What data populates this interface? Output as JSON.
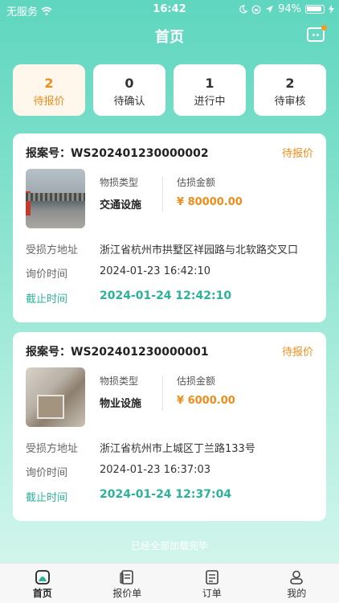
{
  "status_bar": {
    "carrier": "无服务",
    "time": "16:42",
    "battery": "94%"
  },
  "header": {
    "title": "首页"
  },
  "tabs": [
    {
      "count": "2",
      "label": "待报价",
      "active": true
    },
    {
      "count": "0",
      "label": "待确认"
    },
    {
      "count": "1",
      "label": "进行中"
    },
    {
      "count": "2",
      "label": "待审核"
    }
  ],
  "cards": [
    {
      "case_label": "报案号：",
      "case_no": "WS202401230000002",
      "status": "待报价",
      "type_label": "物损类型",
      "type_value": "交通设施",
      "amount_label": "估损金额",
      "amount_value": "¥ 80000.00",
      "address_label": "受损方地址",
      "address_value": "浙江省杭州市拱墅区祥园路与北软路交叉口",
      "inquiry_label": "询价时间",
      "inquiry_value": "2024-01-23 16:42:10",
      "deadline_label": "截止时间",
      "deadline_value": "2024-01-24 12:42:10"
    },
    {
      "case_label": "报案号：",
      "case_no": "WS202401230000001",
      "status": "待报价",
      "type_label": "物损类型",
      "type_value": "物业设施",
      "amount_label": "估损金额",
      "amount_value": "¥ 6000.00",
      "address_label": "受损方地址",
      "address_value": "浙江省杭州市上城区丁兰路133号",
      "inquiry_label": "询价时间",
      "inquiry_value": "2024-01-23 16:37:03",
      "deadline_label": "截止时间",
      "deadline_value": "2024-01-24 12:37:04"
    }
  ],
  "load_tip": "已经全部加载完毕",
  "bottom_nav": [
    {
      "label": "首页",
      "icon": "home-icon",
      "active": true
    },
    {
      "label": "报价单",
      "icon": "quote-icon"
    },
    {
      "label": "订单",
      "icon": "order-icon"
    },
    {
      "label": "我的",
      "icon": "user-icon"
    }
  ],
  "colors": {
    "accent": "#f08c1a",
    "brand": "#2bb39a"
  }
}
